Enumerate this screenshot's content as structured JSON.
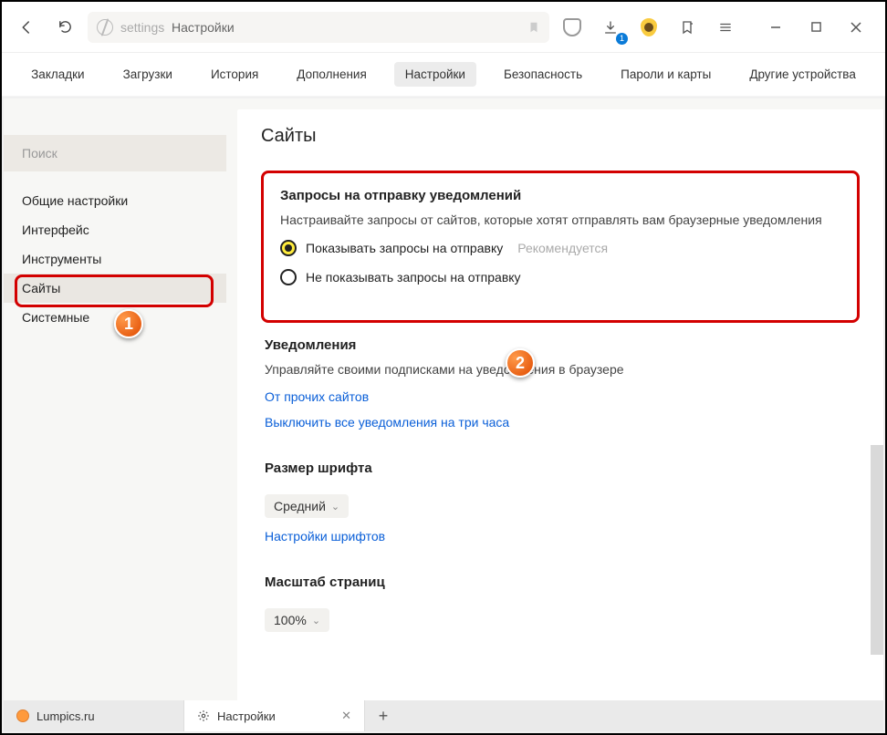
{
  "toolbar": {
    "url_key": "settings",
    "url_title": "Настройки",
    "download_badge": "1"
  },
  "topnav": {
    "items": [
      "Закладки",
      "Загрузки",
      "История",
      "Дополнения",
      "Настройки",
      "Безопасность",
      "Пароли и карты",
      "Другие устройства"
    ],
    "active_index": 4
  },
  "sidebar": {
    "search_placeholder": "Поиск",
    "items": [
      "Общие настройки",
      "Интерфейс",
      "Инструменты",
      "Сайты",
      "Системные"
    ],
    "active_index": 3
  },
  "page": {
    "title": "Сайты",
    "notif_req": {
      "heading": "Запросы на отправку уведомлений",
      "desc": "Настраивайте запросы от сайтов, которые хотят отправлять вам браузерные уведомления",
      "opt1": "Показывать запросы на отправку",
      "opt1_reco": "Рекомендуется",
      "opt2": "Не показывать запросы на отправку"
    },
    "notifications": {
      "heading": "Уведомления",
      "desc": "Управляйте своими подписками на уведомления в браузере",
      "link1": "От прочих сайтов",
      "link2": "Выключить все уведомления на три часа"
    },
    "font_size": {
      "heading": "Размер шрифта",
      "value": "Средний",
      "link": "Настройки шрифтов"
    },
    "scale": {
      "heading": "Масштаб страниц",
      "value": "100%"
    }
  },
  "markers": {
    "one": "1",
    "two": "2"
  },
  "tabs": {
    "items": [
      {
        "label": "Lumpics.ru"
      },
      {
        "label": "Настройки"
      }
    ]
  }
}
